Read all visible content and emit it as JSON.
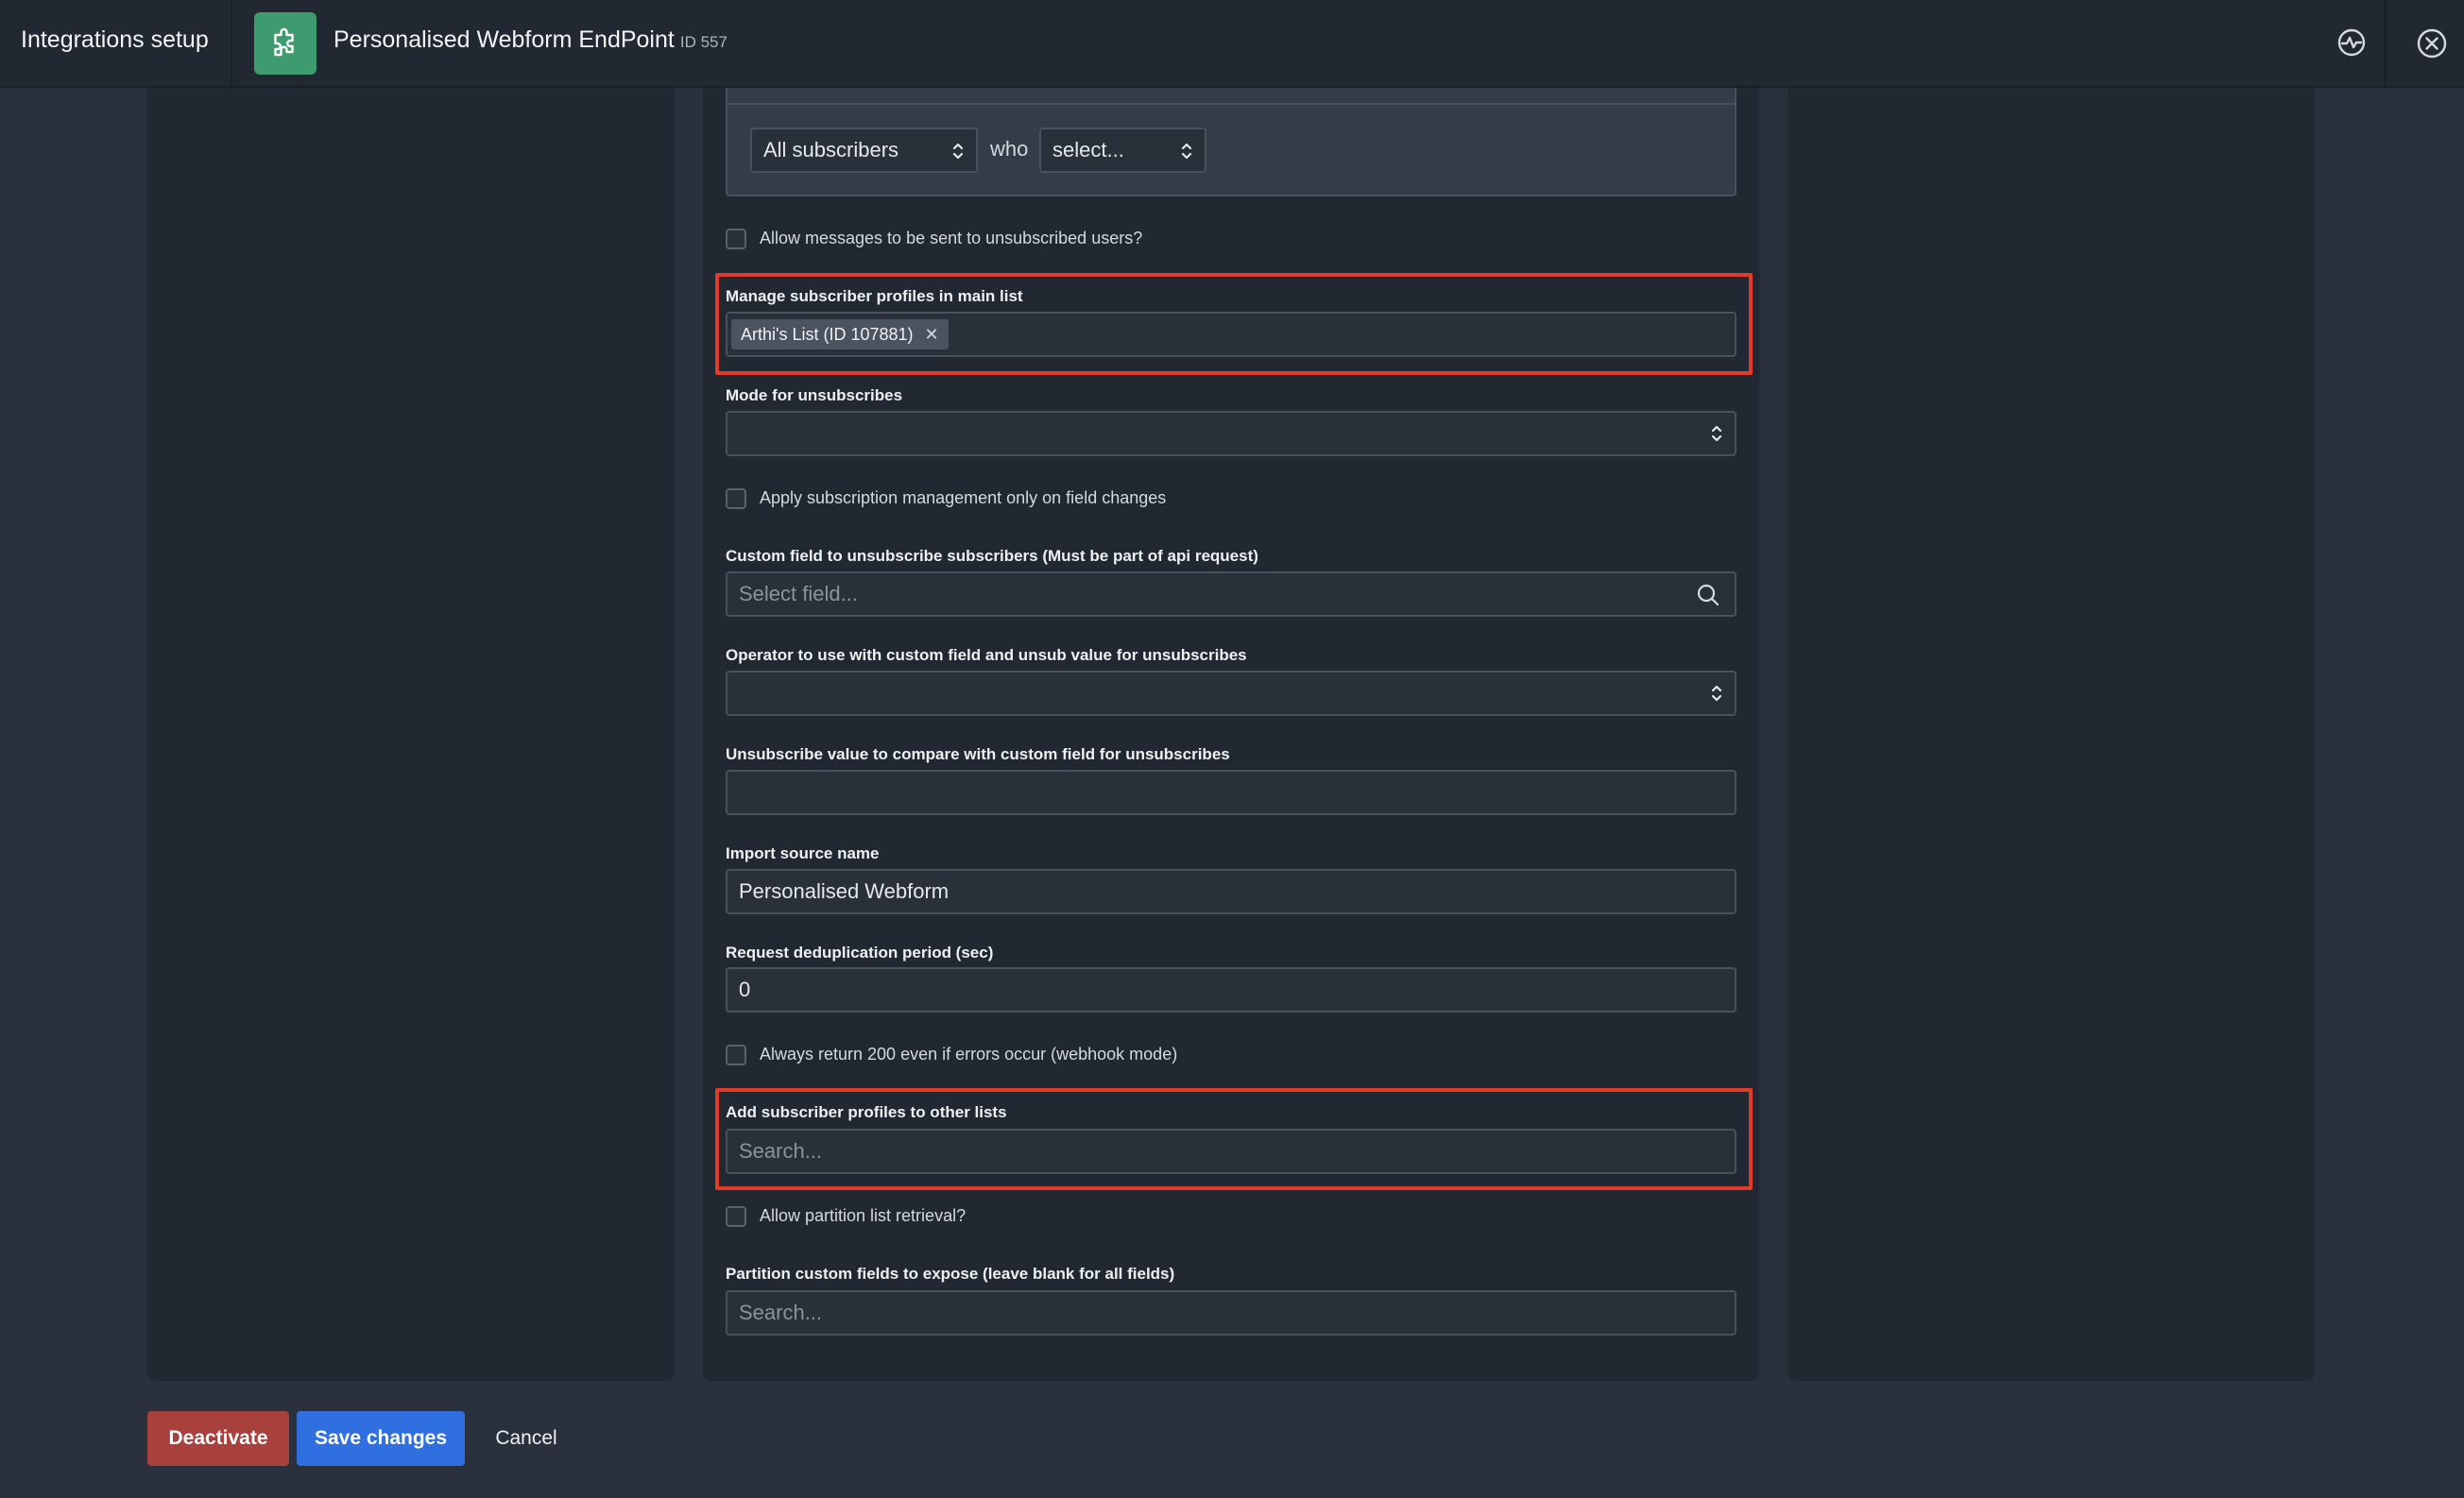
{
  "header": {
    "app_title": "Integrations setup",
    "page_title": "Personalised Webform EndPoint",
    "page_id": "ID 557"
  },
  "filter": {
    "audience_select": "All subscribers",
    "who_label": "who",
    "condition_select": "select..."
  },
  "form": {
    "allow_unsubscribed_label": "Allow messages to be sent to unsubscribed users?",
    "main_list": {
      "label": "Manage subscriber profiles in main list",
      "tags": [
        "Arthi's List (ID 107881)"
      ]
    },
    "mode_unsubscribes": {
      "label": "Mode for unsubscribes",
      "value": ""
    },
    "apply_on_field_changes_label": "Apply subscription management only on field changes",
    "custom_field_unsub": {
      "label": "Custom field to unsubscribe subscribers (Must be part of api request)",
      "placeholder": "Select field..."
    },
    "operator": {
      "label": "Operator to use with custom field and unsub value for unsubscribes",
      "value": ""
    },
    "unsub_value": {
      "label": "Unsubscribe value to compare with custom field for unsubscribes",
      "value": ""
    },
    "import_source": {
      "label": "Import source name",
      "value": "Personalised Webform"
    },
    "dedup_period": {
      "label": "Request deduplication period (sec)",
      "value": "0"
    },
    "always_200_label": "Always return 200 even if errors occur (webhook mode)",
    "other_lists": {
      "label": "Add subscriber profiles to other lists",
      "placeholder": "Search..."
    },
    "partition_retrieval_label": "Allow partition list retrieval?",
    "partition_fields": {
      "label": "Partition custom fields to expose (leave blank for all fields)",
      "placeholder": "Search..."
    }
  },
  "actions": {
    "deactivate": "Deactivate",
    "save": "Save changes",
    "cancel": "Cancel"
  },
  "colors": {
    "plugin_icon_bg": "#3e9a6f",
    "highlight_border": "#e23b2a",
    "deactivate_bg": "#a8403c",
    "save_bg": "#2f6fe0"
  },
  "icons": [
    "plugin-icon",
    "activity-icon",
    "close-icon",
    "search-icon",
    "updown-icon",
    "remove-tag-icon"
  ]
}
